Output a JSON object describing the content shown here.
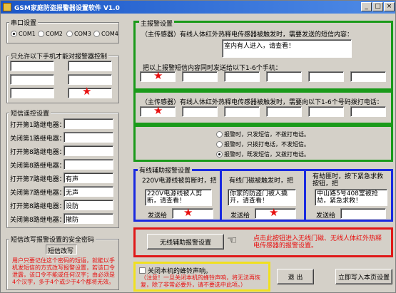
{
  "window": {
    "title": "GSM家庭防盗报警器设置软件 V1.0",
    "min": "_",
    "max": "□",
    "close": "×"
  },
  "serial": {
    "title": "串口设置",
    "ports": [
      "COM1",
      "COM2",
      "COM3",
      "COM4"
    ]
  },
  "phones": {
    "title": "只允许以下手机才能对报警器控制"
  },
  "sms": {
    "title": "短信遥控设置",
    "rows": [
      {
        "label": "打开第1路继电器：",
        "value": ""
      },
      {
        "label": "关闭第1路继电器：",
        "value": ""
      },
      {
        "label": "打开第8路继电器：",
        "value": ""
      },
      {
        "label": "关闭第8路继电器：",
        "value": ""
      },
      {
        "label": "打开第7路继电器：",
        "value": "有声"
      },
      {
        "label": "关闭第7路继电器：",
        "value": "无声"
      },
      {
        "label": "打开第8路继电器：",
        "value": "设防"
      },
      {
        "label": "关闭第8路继电器：",
        "value": "撤防"
      }
    ]
  },
  "password": {
    "title": "短信改写报警设置的安全密码",
    "value": "短信改写",
    "note": "用户只要记住这个密码的短语，就能以手机发短信的方式改写报警设置，若该口令泄露，该口令不能或任何汉字；由必须是4个汉字，多于4个或少于4个都将无效。"
  },
  "host": {
    "title": "主报警设置",
    "sms_prompt": "（主传感器）有线人体红外热释电传感器被触发时，需要发送的短信内容：",
    "sms_content": "室内有人进入，请查看！",
    "send_to_label": "把以上报警短信内容同时发送给以下1-6个手机：",
    "call_prompt": "（主传感器）有线人体红外热释电传感器被触发时，需要向以下1-6个号码拨打电话："
  },
  "alarm_modes": [
    "报警时，只发短信，不拨打电话。",
    "报警时，只拨打电话，不发短信。",
    "报警时，既发短信，又拨打电话。"
  ],
  "aux": {
    "title": "有线辅助报警设置",
    "cols": [
      {
        "label": "220V电源线被剪断时，把",
        "content": "220V电源线被人剪断，请查看！",
        "send": "发送给"
      },
      {
        "label": "有线门磁被触发时，把",
        "content": "你家的防盗门被人撬开，请查看！",
        "send": "发送给"
      },
      {
        "label": "有劫匪时，按下紧急求救按钮，把",
        "content": "中山路5号408室被抢劫，紧急求救！",
        "send": "发送给"
      }
    ]
  },
  "wireless": {
    "button": "无线辅助报警设置",
    "note": "点击此按钮进入无线门磁、无线人体红外热释电传感器的报警设置。"
  },
  "beep": {
    "label": "关闭本机的蜂铃声响。",
    "note": "（注意！一旦关闭本机的蜂铃声响，将无法再恢复，除了非常必要外，请不要选中此项。）"
  },
  "actions": {
    "exit": "退 出",
    "write": "立即写入本页设置"
  }
}
